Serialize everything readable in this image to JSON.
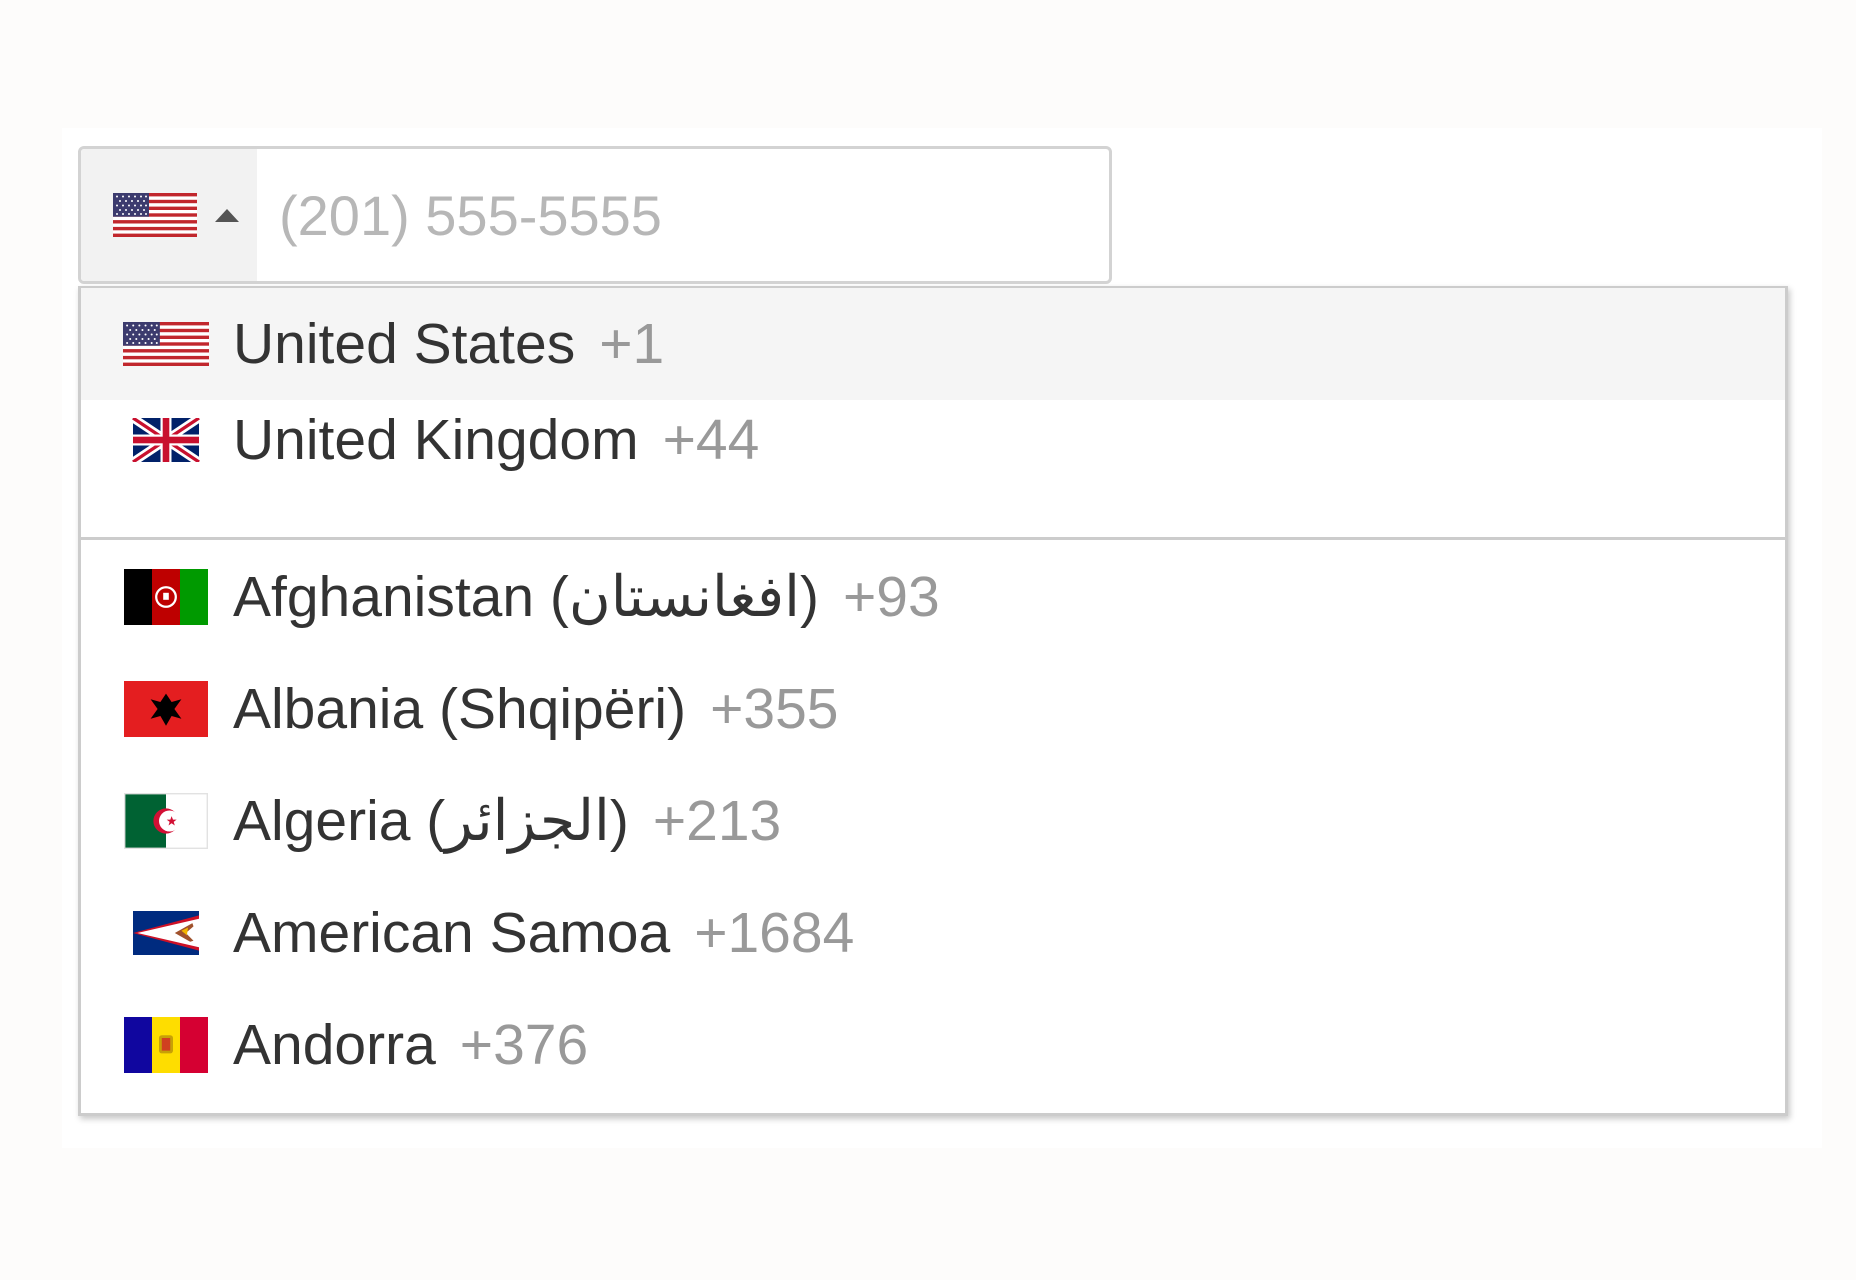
{
  "phone_input": {
    "placeholder": "(201) 555-5555",
    "selected_country": "United States",
    "selected_flag": "us-flag-icon"
  },
  "preferred_countries": [
    {
      "name": "United States",
      "dial_code": "+1",
      "flag": "us-flag-icon",
      "highlighted": true
    },
    {
      "name": "United Kingdom",
      "dial_code": "+44",
      "flag": "gb-flag-icon",
      "highlighted": false
    }
  ],
  "countries": [
    {
      "name": "Afghanistan (افغانستان)",
      "dial_code": "+93",
      "flag": "af-flag-icon"
    },
    {
      "name": "Albania (Shqipëri)",
      "dial_code": "+355",
      "flag": "al-flag-icon"
    },
    {
      "name": "Algeria (الجزائر)",
      "dial_code": "+213",
      "flag": "dz-flag-icon"
    },
    {
      "name": "American Samoa",
      "dial_code": "+1684",
      "flag": "as-flag-icon"
    },
    {
      "name": "Andorra",
      "dial_code": "+376",
      "flag": "ad-flag-icon"
    }
  ],
  "colors": {
    "highlight_bg": "#f5f5f5",
    "border": "#cccccc",
    "name_text": "#333333",
    "dial_code_text": "#999999",
    "placeholder_text": "#b7b7b7"
  }
}
